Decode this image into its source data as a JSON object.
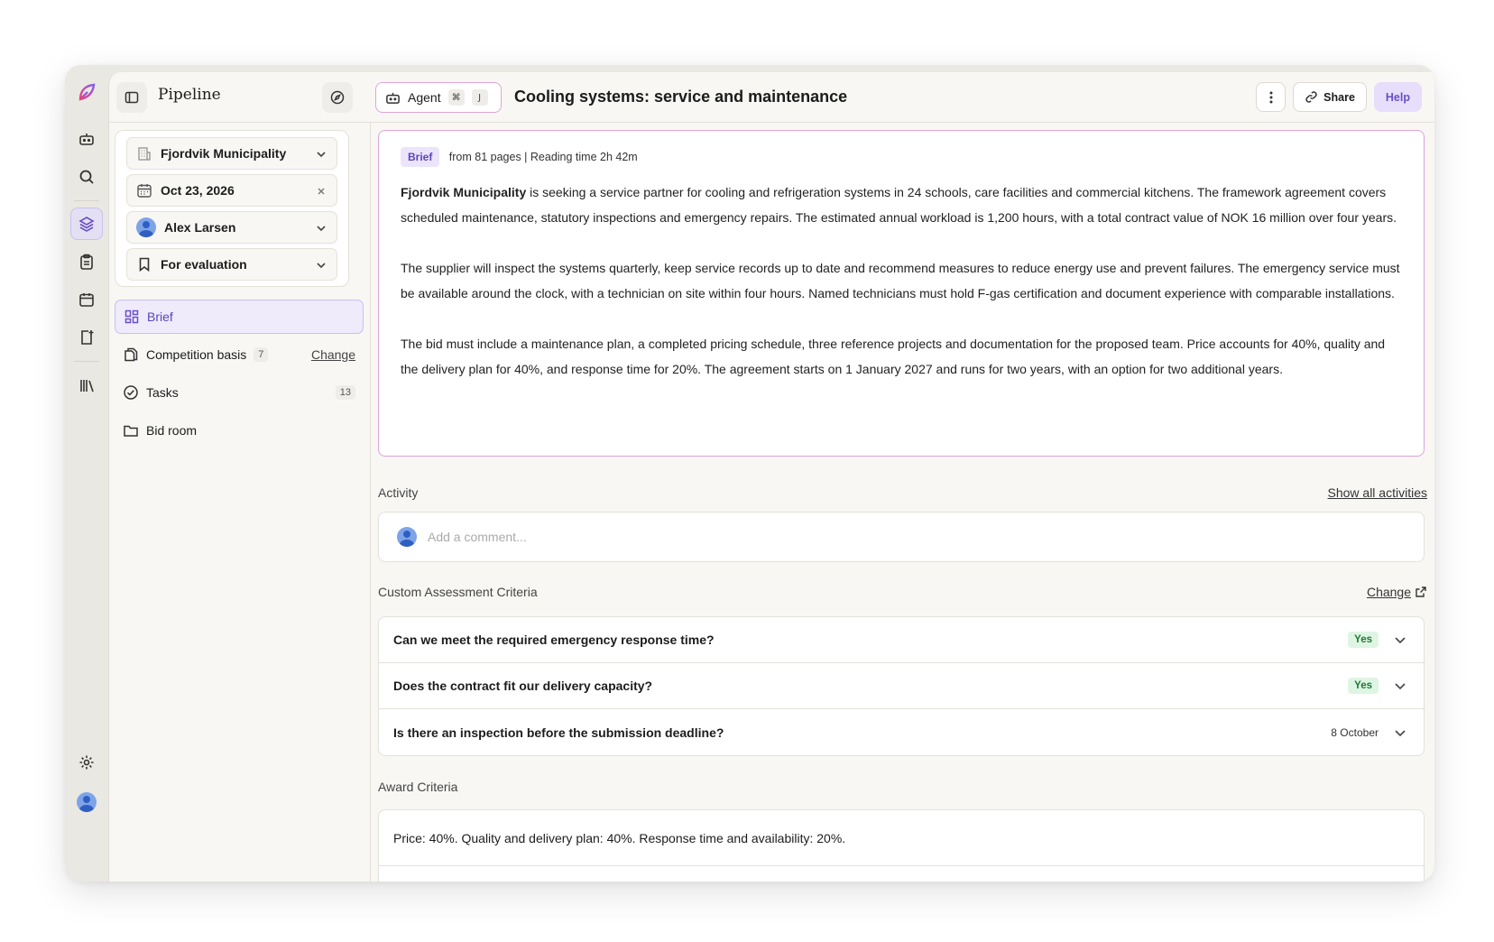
{
  "app": {
    "title": "Pipeline"
  },
  "agent": {
    "label": "Agent",
    "shortcut_mod": "⌘",
    "shortcut_key": "J"
  },
  "page": {
    "title": "Cooling systems: service and maintenance"
  },
  "toolbar": {
    "share_label": "Share",
    "help_label": "Help"
  },
  "filters": {
    "organization": "Fjordvik Municipality",
    "date": "Oct 23, 2026",
    "assignee": "Alex Larsen",
    "status": "For evaluation"
  },
  "nav": {
    "brief": "Brief",
    "competition_basis": "Competition basis",
    "competition_basis_count": "7",
    "change": "Change",
    "tasks": "Tasks",
    "tasks_count": "13",
    "bid_room": "Bid room"
  },
  "brief": {
    "tag": "Brief",
    "meta": "from 81 pages | Reading time 2h 42m",
    "org_bold": "Fjordvik Municipality",
    "p1_rest": " is seeking a service partner for cooling and refrigeration systems in 24 schools, care facilities and commercial kitchens. The framework agreement covers scheduled maintenance, statutory inspections and emergency repairs. The estimated annual workload is 1,200 hours, with a total contract value of NOK 16 million over four years.",
    "p2": "The supplier will inspect the systems quarterly, keep service records up to date and recommend measures to reduce energy use and prevent failures. The emergency service must be available around the clock, with a technician on site within four hours. Named technicians must hold F-gas certification and document experience with comparable installations.",
    "p3": "The bid must include a maintenance plan, a completed pricing schedule, three reference projects and documentation for the proposed team. Price accounts for 40%, quality and the delivery plan for 40%, and response time for 20%. The agreement starts on 1 January 2027 and runs for two years, with an option for two additional years."
  },
  "activity": {
    "label": "Activity",
    "show_all": "Show all activities",
    "comment_placeholder": "Add a comment..."
  },
  "custom_criteria": {
    "label": "Custom Assessment Criteria",
    "change": "Change",
    "items": [
      {
        "question": "Can we meet the required emergency response time?",
        "answer": "Yes"
      },
      {
        "question": "Does the contract fit our delivery capacity?",
        "answer": "Yes"
      },
      {
        "question": "Is there an inspection before the submission deadline?",
        "answer": "8 October"
      }
    ]
  },
  "award": {
    "label": "Award Criteria",
    "text": "Price: 40%. Quality and delivery plan: 40%. Response time and availability: 20%."
  },
  "colors": {
    "accent": "#6b4fc4",
    "brief_border": "#dba4d6",
    "yes_bg": "#dff5e3",
    "yes_text": "#1e7a34",
    "logo_start": "#e8447a",
    "logo_end": "#8a5cf0"
  }
}
